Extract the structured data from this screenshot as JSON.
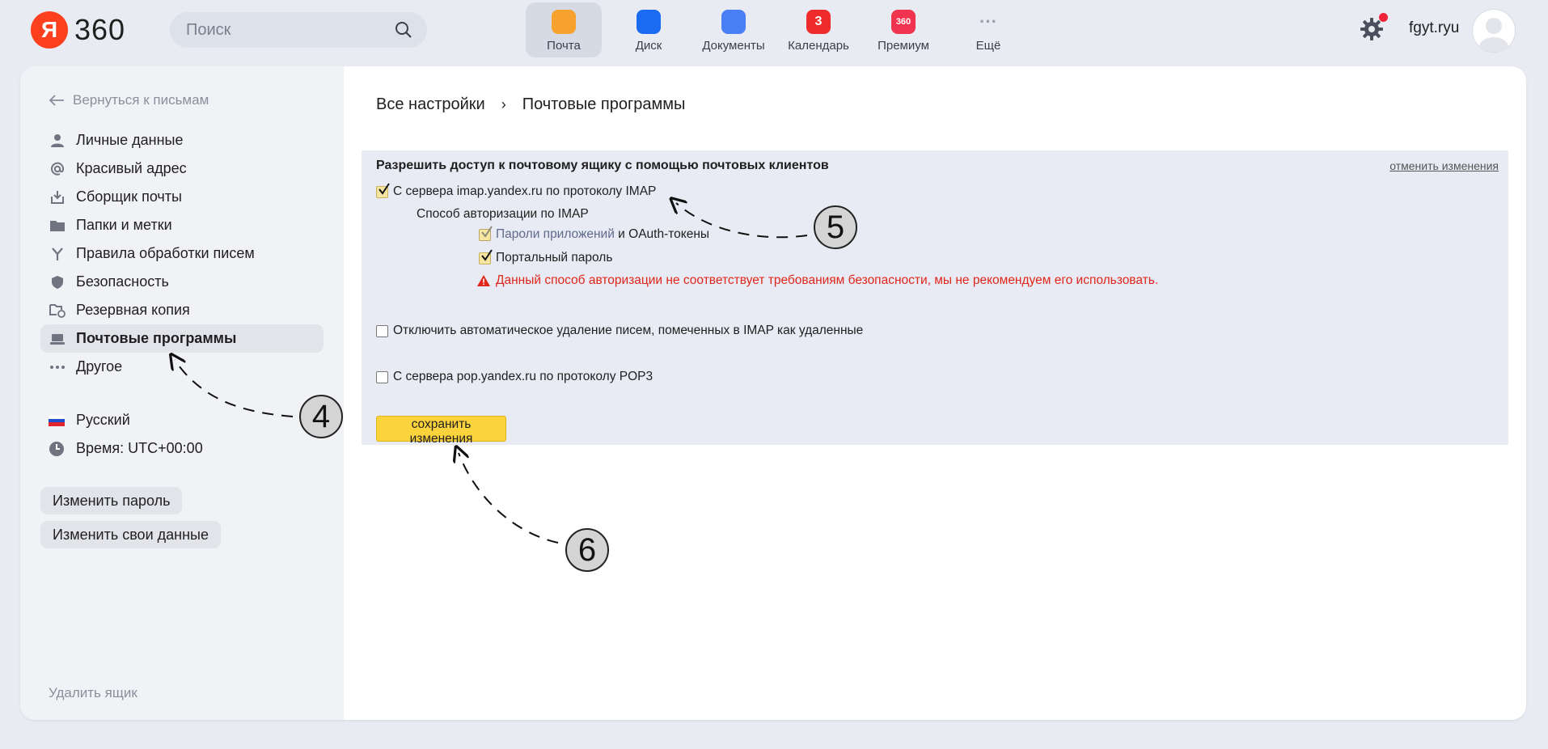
{
  "header": {
    "logo_text": "360",
    "search_placeholder": "Поиск",
    "apps": [
      {
        "label": "Почта",
        "active": true,
        "color": "#f7a22f",
        "icon": "mail-icon",
        "badge": ""
      },
      {
        "label": "Диск",
        "active": false,
        "color": "#1b6bf2",
        "icon": "disk-icon",
        "badge": ""
      },
      {
        "label": "Документы",
        "active": false,
        "color": "#4a7ef7",
        "icon": "documents-icon",
        "badge": ""
      },
      {
        "label": "Календарь",
        "active": false,
        "color": "#ef2b2b",
        "icon": "calendar-icon",
        "badge": "3"
      },
      {
        "label": "Премиум",
        "active": false,
        "color": "#f0334f",
        "icon": "premium-icon",
        "badge": "360"
      },
      {
        "label": "Ещё",
        "active": false,
        "color": "#9aa0ad",
        "icon": "more-icon",
        "badge": "···"
      }
    ],
    "username": "fgyt.ryu"
  },
  "sidebar": {
    "back_label": "Вернуться к письмам",
    "items": [
      {
        "label": "Личные данные",
        "icon": "person-icon",
        "active": false
      },
      {
        "label": "Красивый адрес",
        "icon": "at-icon",
        "active": false
      },
      {
        "label": "Сборщик почты",
        "icon": "inbox-download-icon",
        "active": false
      },
      {
        "label": "Папки и метки",
        "icon": "folder-icon",
        "active": false
      },
      {
        "label": "Правила обработки писем",
        "icon": "fork-icon",
        "active": false
      },
      {
        "label": "Безопасность",
        "icon": "shield-icon",
        "active": false
      },
      {
        "label": "Резервная копия",
        "icon": "backup-icon",
        "active": false
      },
      {
        "label": "Почтовые программы",
        "icon": "laptop-icon",
        "active": true
      },
      {
        "label": "Другое",
        "icon": "dots-icon",
        "active": false
      }
    ],
    "language": "Русский",
    "timezone": "Время: UTC+00:00",
    "change_password": "Изменить пароль",
    "change_data": "Изменить свои данные",
    "delete_mailbox": "Удалить ящик"
  },
  "breadcrumb": {
    "root": "Все настройки",
    "separator": "›",
    "current": "Почтовые программы"
  },
  "settings": {
    "title": "Разрешить доступ к почтовому ящику с помощью почтовых клиентов",
    "cancel_changes": "отменить изменения",
    "imap_label": "С сервера imap.yandex.ru по протоколу IMAP",
    "imap_checked": true,
    "auth_method_label": "Способ авторизации по IMAP",
    "app_passwords_link": "Пароли приложений",
    "app_passwords_suffix": " и OAuth-токены",
    "app_passwords_checked": true,
    "portal_password_label": "Портальный пароль",
    "portal_password_checked": true,
    "warning_text": "Данный способ авторизации не соответствует требованиям безопасности, мы не рекомендуем его использовать.",
    "disable_autodelete_label": "Отключить автоматическое удаление писем, помеченных в IMAP как удаленные",
    "disable_autodelete_checked": false,
    "pop3_label": "С сервера pop.yandex.ru по протоколу POP3",
    "pop3_checked": false,
    "save_button": "сохранить изменения"
  },
  "annotations": {
    "marker_4": "4",
    "marker_5": "5",
    "marker_6": "6"
  },
  "colors": {
    "accent_yellow": "#fbd33c",
    "warning_red": "#e0261b",
    "logo_red": "#fc3f1d"
  }
}
